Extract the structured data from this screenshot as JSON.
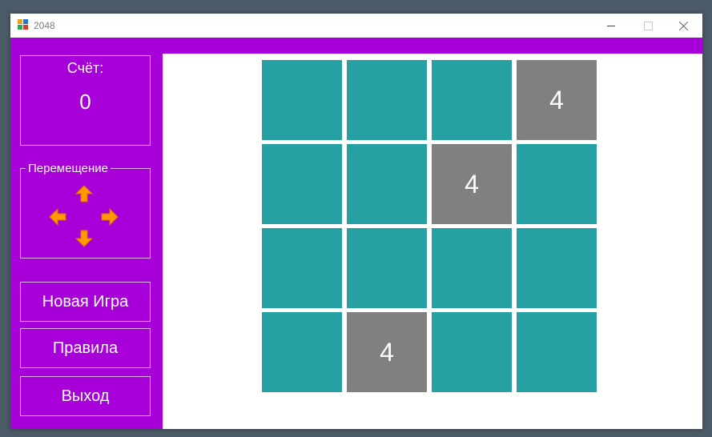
{
  "window": {
    "title": "2048"
  },
  "sidebar": {
    "score_label": "Счёт:",
    "score_value": "0",
    "move_legend": "Перемещение",
    "buttons": {
      "new_game": "Новая Игра",
      "rules": "Правила",
      "exit": "Выход"
    }
  },
  "board": {
    "rows": [
      [
        "",
        "",
        "",
        "4"
      ],
      [
        "",
        "",
        "4",
        ""
      ],
      [
        "",
        "",
        "",
        ""
      ],
      [
        "",
        "4",
        "",
        ""
      ]
    ]
  },
  "colors": {
    "accent": "#a800d8",
    "empty_tile": "#26a0a2",
    "filled_tile": "#808080",
    "arrow": "#ff9900"
  }
}
